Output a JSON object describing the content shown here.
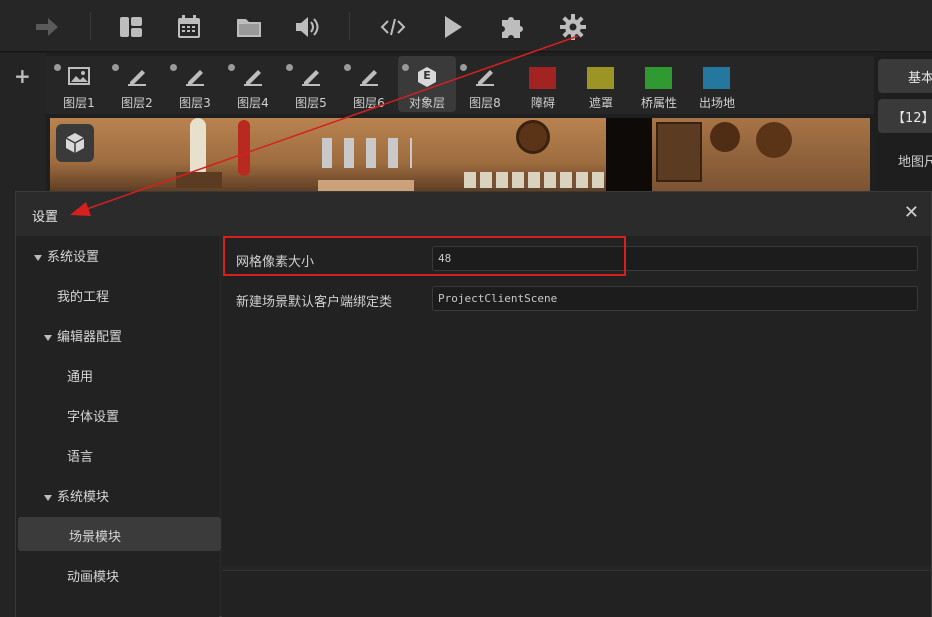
{
  "toolbar": {
    "items": [
      {
        "name": "forward-icon"
      },
      {
        "name": "layout-icon"
      },
      {
        "name": "calendar-icon"
      },
      {
        "name": "folder-icon"
      },
      {
        "name": "sound-icon"
      },
      {
        "name": "code-icon"
      },
      {
        "name": "play-icon"
      },
      {
        "name": "puzzle-icon"
      },
      {
        "name": "gear-icon"
      }
    ]
  },
  "add_label": "+",
  "layers": [
    {
      "label": "图层1",
      "icon": "image-icon"
    },
    {
      "label": "图层2",
      "icon": "pen-icon"
    },
    {
      "label": "图层3",
      "icon": "pen-icon"
    },
    {
      "label": "图层4",
      "icon": "pen-icon"
    },
    {
      "label": "图层5",
      "icon": "pen-icon"
    },
    {
      "label": "图层6",
      "icon": "pen-icon"
    },
    {
      "label": "对象层",
      "icon": "e-badge-icon",
      "badge": "E",
      "active": true
    },
    {
      "label": "图层8",
      "icon": "pen-icon"
    },
    {
      "label": "障碍",
      "color": "#a32222"
    },
    {
      "label": "遮罩",
      "color": "#9c9425"
    },
    {
      "label": "桥属性",
      "color": "#2f9a2f"
    },
    {
      "label": "出场地",
      "color": "#24779e"
    }
  ],
  "right_panel": {
    "tab_basic": "基本",
    "item_label": "【12】",
    "map_size_label": "地图尺"
  },
  "dialog": {
    "title": "设置",
    "close": "✕",
    "tree": [
      {
        "label": "系统设置",
        "expanded": true
      },
      {
        "label": "我的工程"
      },
      {
        "label": "编辑器配置",
        "expanded": true
      },
      {
        "label": "通用"
      },
      {
        "label": "字体设置"
      },
      {
        "label": "语言"
      },
      {
        "label": "系统模块",
        "expanded": true
      },
      {
        "label": "场景模块",
        "selected": true
      },
      {
        "label": "动画模块"
      }
    ],
    "fields": [
      {
        "label": "网格像素大小",
        "value": "48"
      },
      {
        "label": "新建场景默认客户端绑定类",
        "value": "ProjectClientScene"
      }
    ]
  },
  "annotation_color": "#d62020"
}
